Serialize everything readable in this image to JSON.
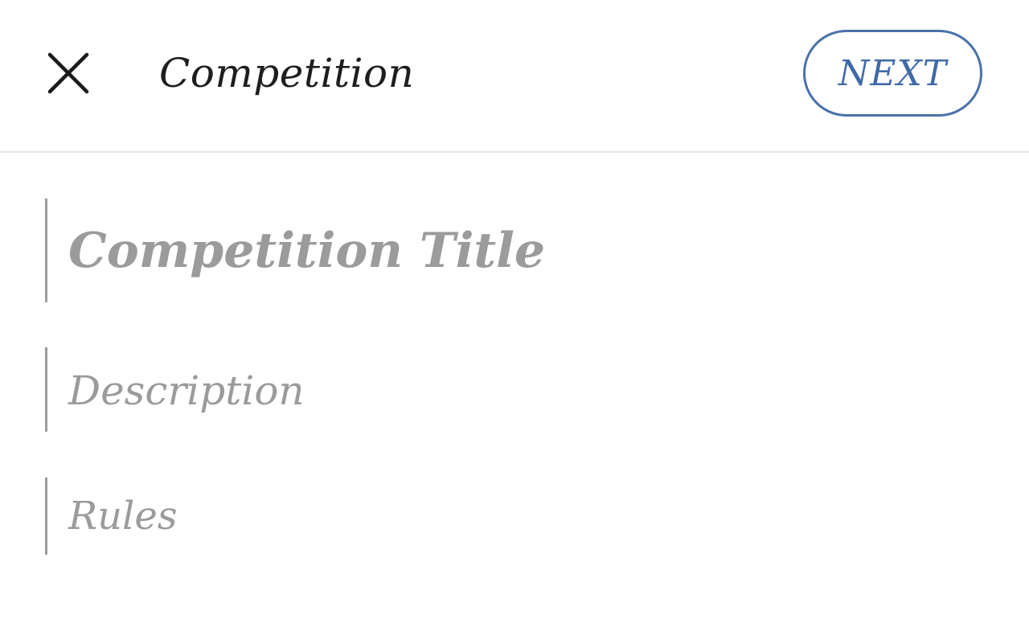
{
  "header": {
    "title": "Competition",
    "close_icon": "close-icon",
    "next_label": "NEXT",
    "accent_color": "#3f69a8"
  },
  "form": {
    "title_placeholder": "Competition Title",
    "description_placeholder": "Description",
    "rules_placeholder": "Rules"
  }
}
